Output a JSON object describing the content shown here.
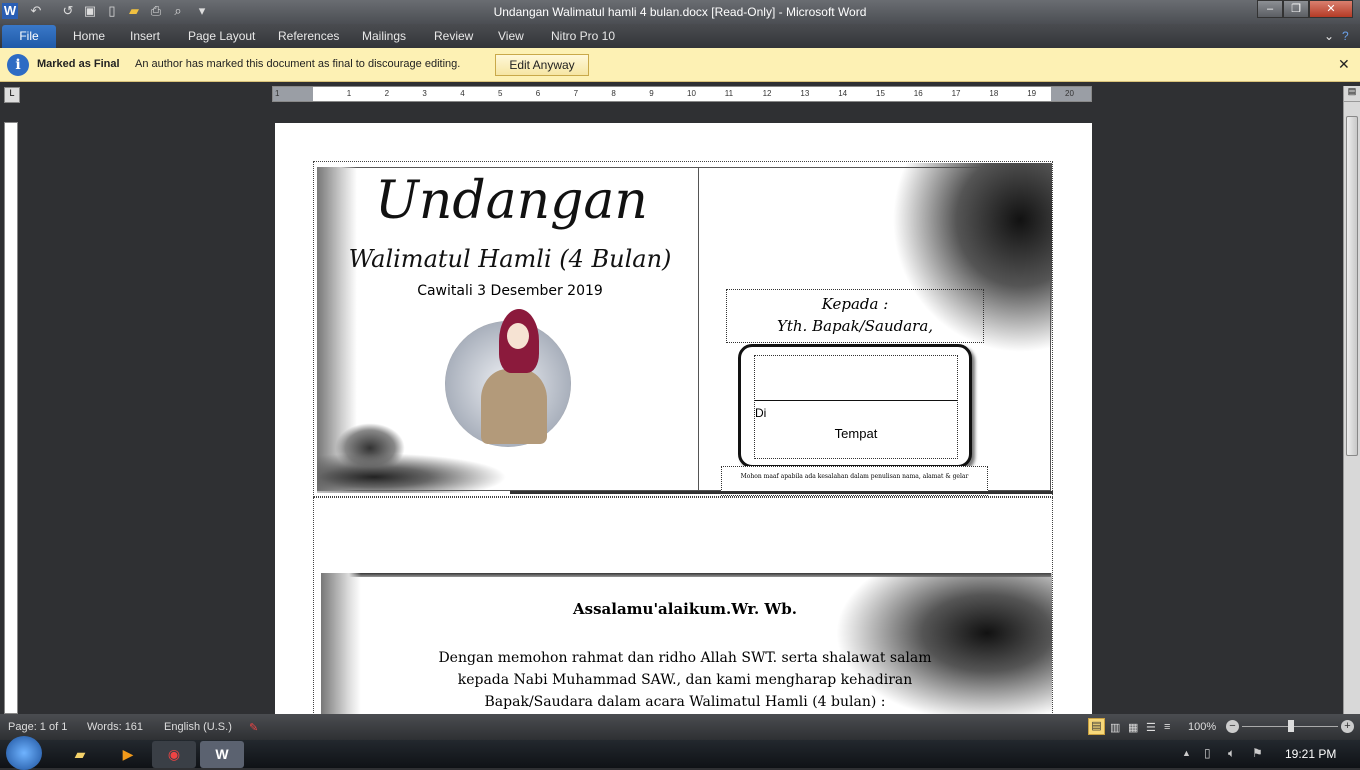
{
  "window": {
    "title": "Undangan Walimatul hamli 4 bulan.docx [Read-Only] - Microsoft Word"
  },
  "ribbon": {
    "tabs": [
      "File",
      "Home",
      "Insert",
      "Page Layout",
      "References",
      "Mailings",
      "Review",
      "View",
      "Nitro Pro 10"
    ]
  },
  "infobar": {
    "title": "Marked as Final",
    "message": "An author has marked this document as final to discourage editing.",
    "button": "Edit Anyway"
  },
  "ruler": {
    "numbers": [
      "1",
      "1",
      "2",
      "3",
      "4",
      "5",
      "6",
      "7",
      "8",
      "9",
      "10",
      "11",
      "12",
      "13",
      "14",
      "15",
      "16",
      "17",
      "18",
      "19",
      "20"
    ]
  },
  "document": {
    "title": "Undangan",
    "subtitle": "Walimatul Hamli (4 Bulan)",
    "place_date": "Cawitali 3 Desember 2019",
    "to_label": "Kepada :",
    "to_name": "Yth. Bapak/Saudara,",
    "di": "Di",
    "tempat": "Tempat",
    "apology": "Mohon maaf apabila ada kesalahan dalam penulisan  nama, alamat & gelar",
    "greeting": "Assalamu'alaikum.Wr. Wb.",
    "body_lines": [
      "Dengan memohon rahmat dan ridho Allah SWT. serta shalawat  salam",
      "kepada Nabi Muhammad SAW., dan kami mengharap kehadiran",
      "Bapak/Saudara dalam acara Walimatul Hamli (4 bulan) :"
    ]
  },
  "status": {
    "page": "Page: 1 of 1",
    "words": "Words: 161",
    "language": "English (U.S.)",
    "zoom": "100%",
    "zoom_percent": 100
  },
  "taskbar": {
    "time": "19:21 PM"
  },
  "colors": {
    "infobar": "#fdf1b4",
    "file_tab": "#2a66b8",
    "hijab": "#8b1a3c"
  }
}
